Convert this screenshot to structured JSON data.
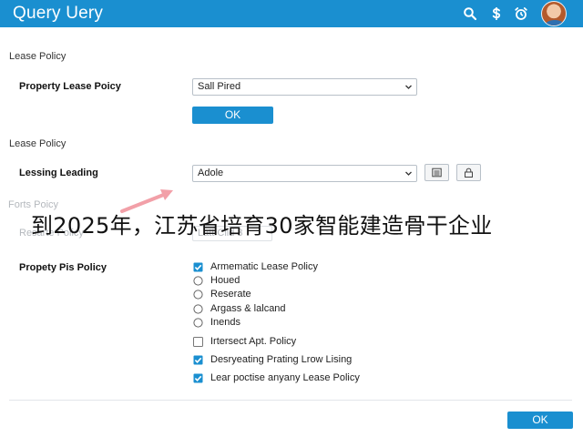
{
  "app": {
    "title": "Query Uery",
    "accent_color": "#1a8fd0",
    "icons": [
      "search-icon",
      "dollar-icon",
      "alarm-icon"
    ]
  },
  "sections": {
    "first_title": "Lease Policy",
    "second_title": "Lease Policy",
    "faded_title": "Forts Poicy"
  },
  "property_lease": {
    "label": "Property Lease Poicy",
    "selected": "Sall Pired",
    "ok_label": "OK"
  },
  "leasing": {
    "label": "Lessing Leading",
    "selected": "Adole",
    "tool_icons": [
      "list-icon",
      "lock-icon"
    ]
  },
  "faded_row": {
    "label": "Resarte Policy",
    "value": "Latt Clid 3"
  },
  "overlay_text": "到2025年，江苏省培育30家智能建造骨干企业",
  "policy_group": {
    "label": "Propety Pis Policy",
    "options": [
      {
        "kind": "checkbox",
        "checked": true,
        "label": "Armematic Lease Policy"
      },
      {
        "kind": "radio",
        "checked": false,
        "label": "Houed"
      },
      {
        "kind": "radio",
        "checked": false,
        "label": "Reserate"
      },
      {
        "kind": "radio",
        "checked": false,
        "label": "Argass & lalcand"
      },
      {
        "kind": "radio",
        "checked": false,
        "label": "Inends"
      },
      {
        "kind": "checkbox",
        "checked": false,
        "label": "Irtersect Apt. Policy"
      },
      {
        "kind": "checkbox",
        "checked": true,
        "label": "Desryeating Prating Lrow Lising"
      },
      {
        "kind": "checkbox",
        "checked": true,
        "label": "Lear poctise anyany Lease Policy"
      }
    ]
  },
  "footer": {
    "ok_label": "OK"
  }
}
